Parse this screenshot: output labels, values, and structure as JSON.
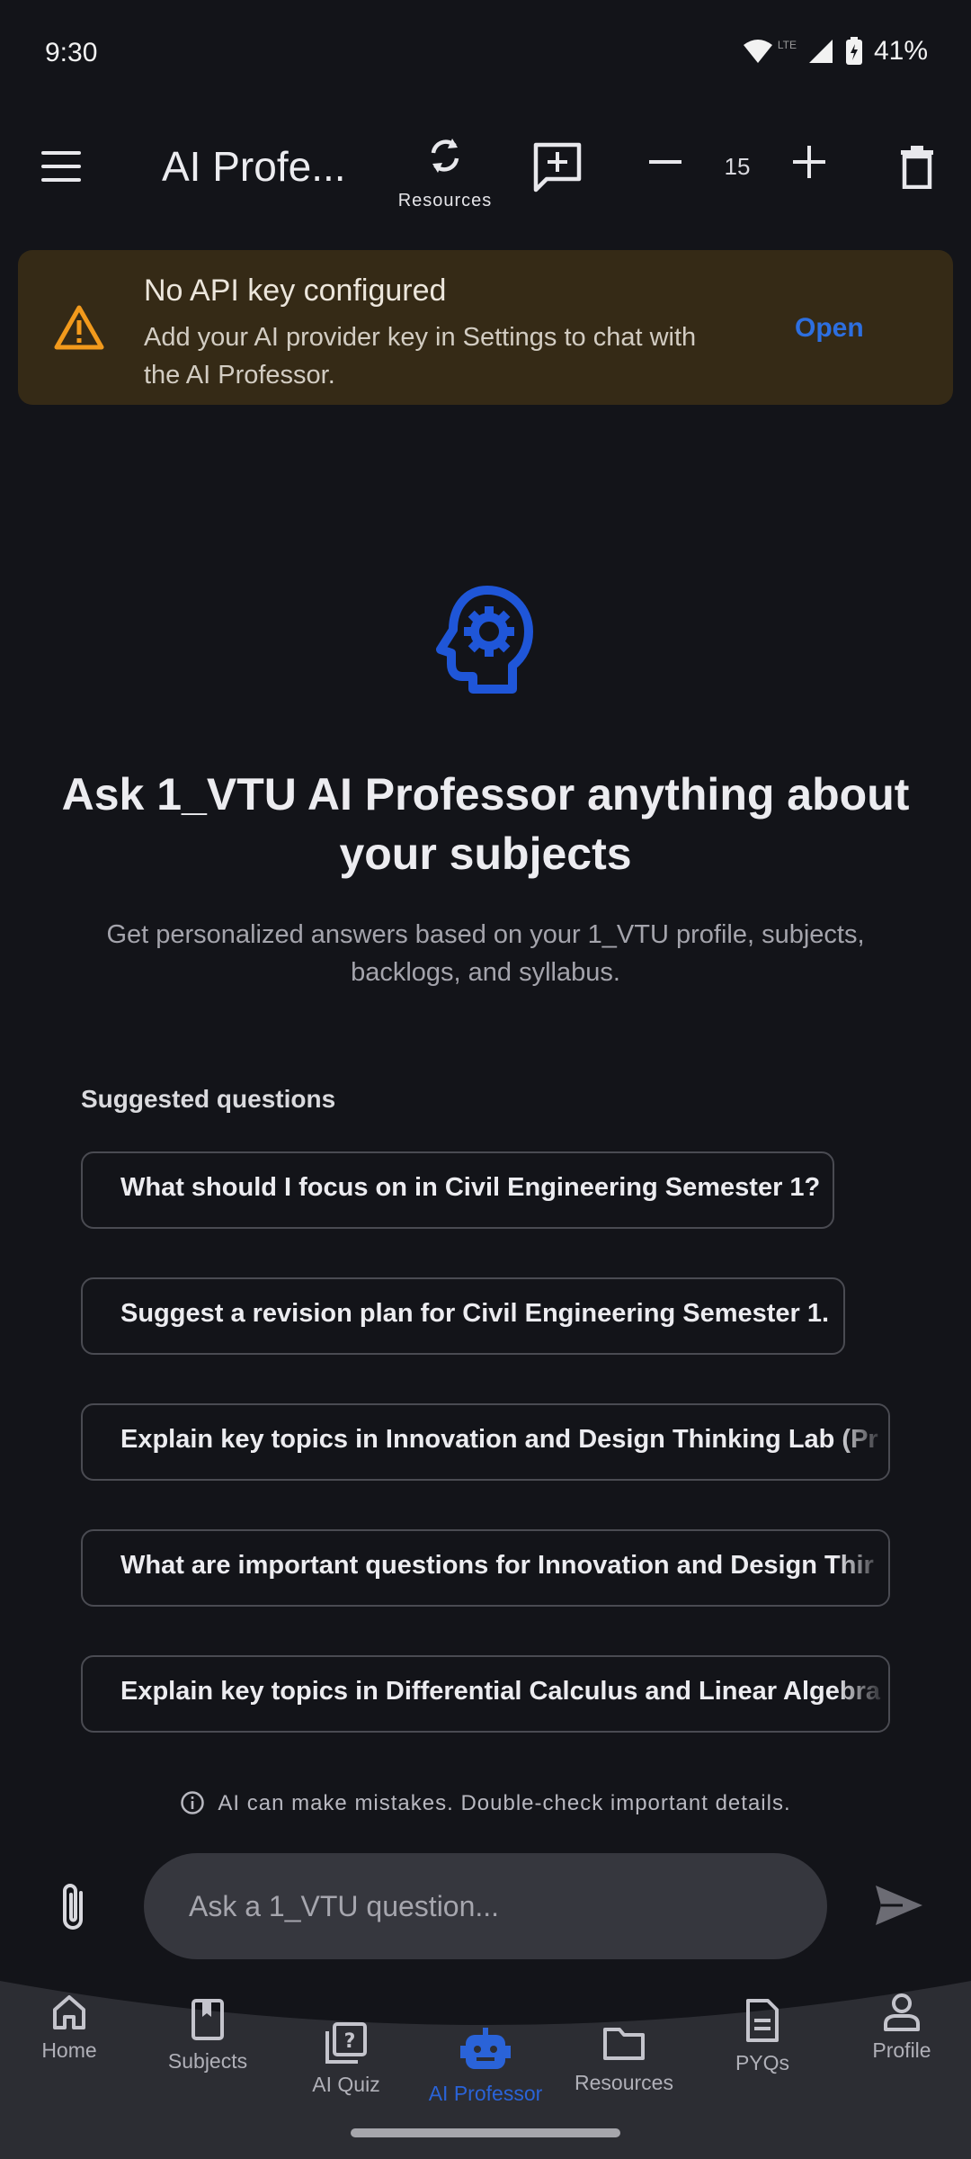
{
  "status_bar": {
    "time": "9:30",
    "battery": "41%",
    "network_badge": "LTE"
  },
  "app_bar": {
    "title": "AI Profe...",
    "resources_label": "Resources",
    "font_size": "15",
    "icons": [
      "menu-icon",
      "refresh-icon",
      "new-chat-icon",
      "minus-icon",
      "plus-icon",
      "trash-icon"
    ]
  },
  "banner": {
    "title": "No API key configured",
    "message": "Add your AI provider key in Settings to chat with the AI Professor.",
    "action": "Open"
  },
  "hero": {
    "title": "Ask 1_VTU AI Professor anything about your subjects",
    "subtitle": "Get personalized answers based on your 1_VTU profile, subjects, backlogs, and syllabus."
  },
  "suggestions": {
    "heading": "Suggested questions",
    "items": [
      "What should I focus on in Civil Engineering Semester 1?",
      "Suggest a revision plan for Civil Engineering Semester 1.",
      "Explain key topics in Innovation and Design Thinking Lab (Pr",
      "What are important questions for Innovation and Design Thir",
      "Explain key topics in Differential Calculus and Linear Algebra"
    ]
  },
  "disclaimer": "AI can make mistakes. Double-check important details.",
  "input": {
    "placeholder": "Ask a 1_VTU question..."
  },
  "nav": {
    "items": [
      "Home",
      "Subjects",
      "AI Quiz",
      "AI Professor",
      "Resources",
      "PYQs",
      "Profile"
    ],
    "active": "AI Professor"
  },
  "colors": {
    "background": "#131419",
    "accent": "#2a63d8",
    "banner_bg": "#352a16",
    "warning": "#f29a1c",
    "nav_bg": "#2c2d33"
  }
}
